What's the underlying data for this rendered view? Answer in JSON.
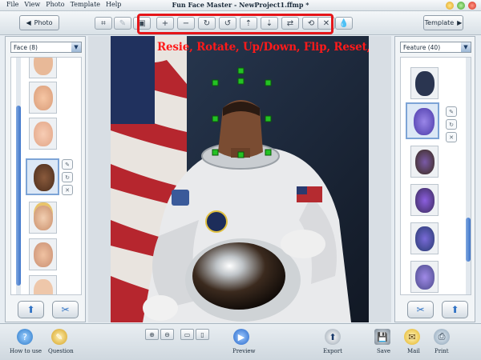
{
  "menu": [
    "File",
    "View",
    "Photo",
    "Template",
    "Help"
  ],
  "window_title": "Fun Face Master - NewProject1.ffmp *",
  "nav": {
    "photo_label": "Photo",
    "template_label": "Template"
  },
  "caption": "Resie, Rotate, Up/Down, Flip, Reset, Delete",
  "left_panel": {
    "dropdown_value": "Face (8)",
    "scroll_fraction": 0.55
  },
  "right_panel": {
    "dropdown_value": "Feature (40)",
    "scroll_fraction": 0.45
  },
  "bottom": {
    "how_to_use": "How to use",
    "question": "Question",
    "preview": "Preview",
    "export": "Export",
    "save": "Save",
    "mail": "Mail",
    "print": "Print"
  },
  "colors": {
    "highlight": "#e5161a",
    "caption": "#ff1a1a",
    "accent": "#3d74c9"
  },
  "icons": {
    "toolbar": [
      "crop-icon",
      "pencil-icon",
      "layers-icon",
      "zoom-in-icon",
      "zoom-out-icon",
      "rotate-right-icon",
      "rotate-left-icon",
      "move-up-icon",
      "move-down-icon",
      "flip-icon",
      "reset-icon",
      "delete-icon",
      "drop-icon"
    ]
  }
}
